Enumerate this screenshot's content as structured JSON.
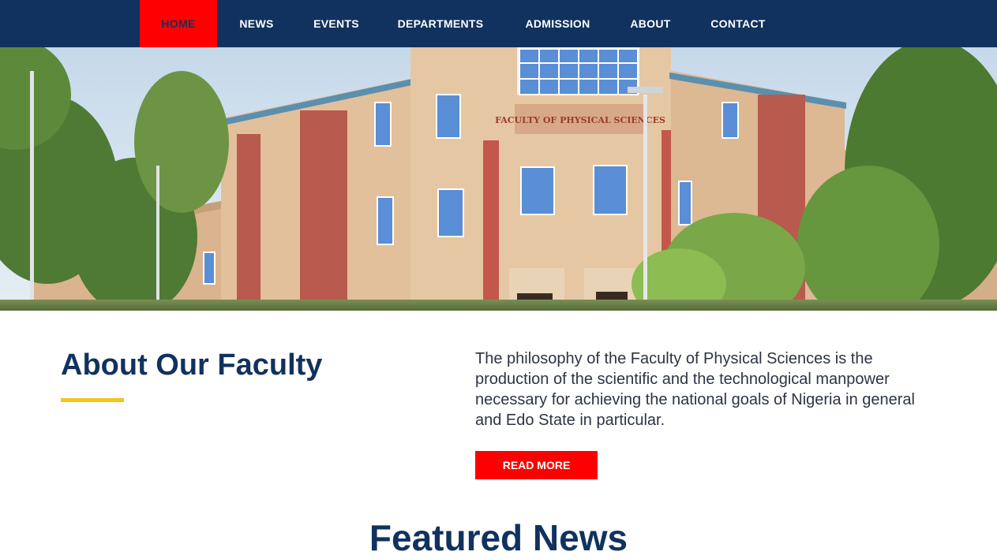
{
  "nav": {
    "items": [
      {
        "label": "HOME",
        "active": true
      },
      {
        "label": "NEWS",
        "active": false
      },
      {
        "label": "EVENTS",
        "active": false
      },
      {
        "label": "DEPARTMENTS",
        "active": false
      },
      {
        "label": "ADMISSION",
        "active": false
      },
      {
        "label": "ABOUT",
        "active": false
      },
      {
        "label": "CONTACT",
        "active": false
      }
    ]
  },
  "hero": {
    "building_sign": "FACULTY OF PHYSICAL SCIENCES"
  },
  "about": {
    "title": "About Our Faculty",
    "text": "The philosophy of the Faculty of Physical Sciences is the production of the scientific and the technological manpower necessary for achieving the national goals of Nigeria in general and Edo State in particular.",
    "button_label": "READ MORE"
  },
  "featured": {
    "title": "Featured News"
  },
  "colors": {
    "nav_bg": "#11325e",
    "accent_red": "#ff0000",
    "underline_yellow": "#f5c518",
    "heading_blue": "#11325e"
  }
}
